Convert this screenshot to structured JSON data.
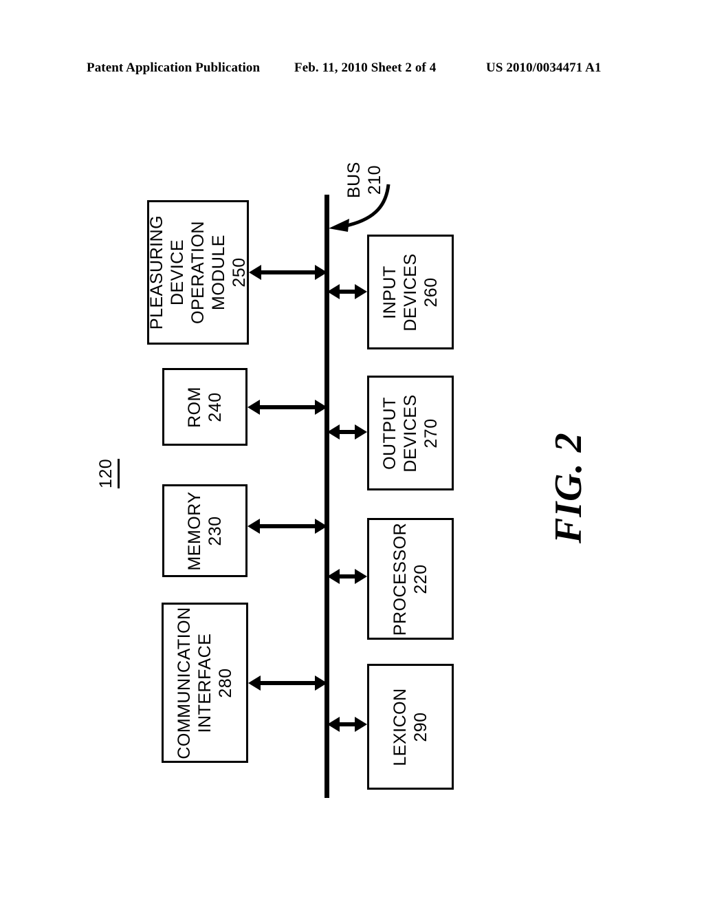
{
  "page_header": {
    "left": "Patent Application Publication",
    "middle": "Feb. 11, 2010  Sheet 2 of 4",
    "right": "US 2010/0034471 A1"
  },
  "figure": {
    "caption": "FIG. 2",
    "system_reference_numeral": "120",
    "bus": {
      "label": "BUS",
      "numeral": "210"
    },
    "blocks": [
      {
        "id": "pleasuring-device-operation-module",
        "lines": [
          "PLEASURING",
          "DEVICE",
          "OPERATION",
          "MODULE"
        ],
        "numeral": "250"
      },
      {
        "id": "rom",
        "lines": [
          "ROM"
        ],
        "numeral": "240"
      },
      {
        "id": "memory",
        "lines": [
          "MEMORY"
        ],
        "numeral": "230"
      },
      {
        "id": "communication-interface",
        "lines": [
          "COMMUNICATION",
          "INTERFACE"
        ],
        "numeral": "280"
      },
      {
        "id": "input-devices",
        "lines": [
          "INPUT",
          "DEVICES"
        ],
        "numeral": "260"
      },
      {
        "id": "output-devices",
        "lines": [
          "OUTPUT",
          "DEVICES"
        ],
        "numeral": "270"
      },
      {
        "id": "processor",
        "lines": [
          "PROCESSOR"
        ],
        "numeral": "220"
      },
      {
        "id": "lexicon",
        "lines": [
          "LEXICON"
        ],
        "numeral": "290"
      }
    ]
  },
  "colors": {
    "ink": "#000000",
    "paper": "#ffffff"
  }
}
